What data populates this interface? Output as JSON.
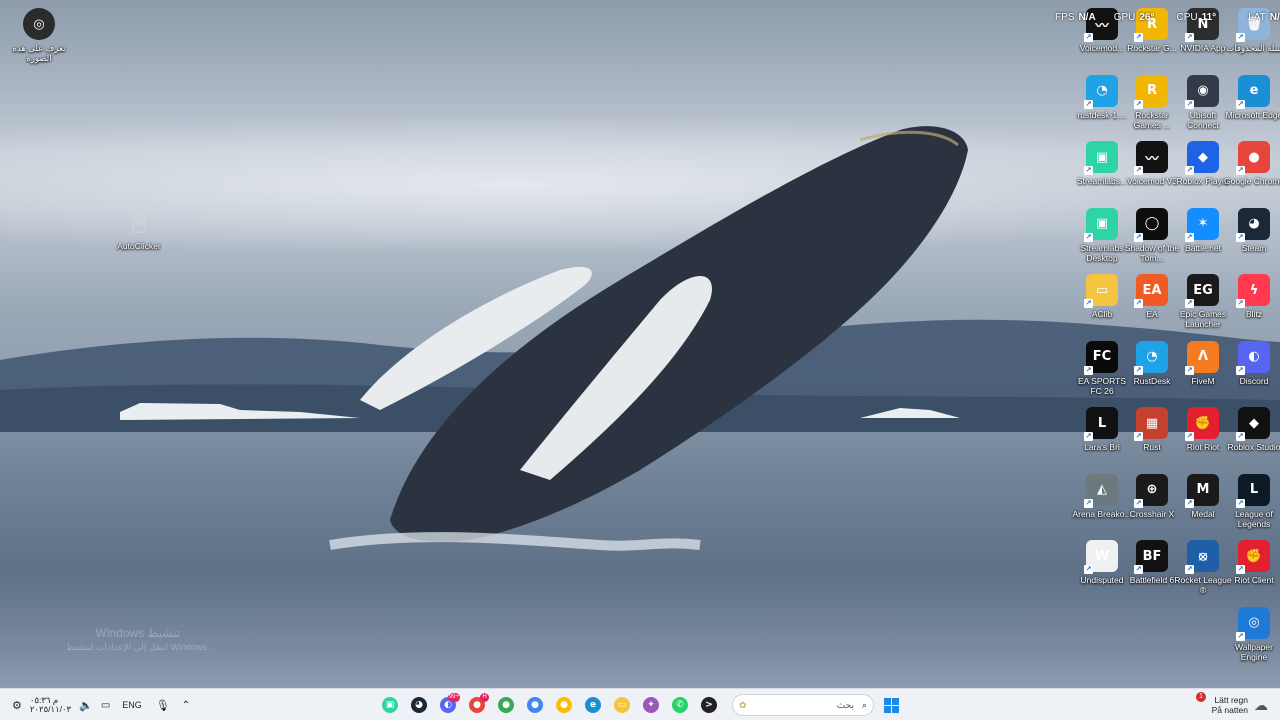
{
  "overlay": {
    "fps_label": "FPS",
    "fps_value": "N/A",
    "gpu_label": "GPU",
    "gpu_value": "26°",
    "cpu_label": "CPU",
    "cpu_value": "11°",
    "lat_label": "LAT",
    "lat_value": "N/A"
  },
  "desktop": {
    "left_icons": [
      {
        "name": "web-shortcut",
        "label": "تعرف على هذه الصورة",
        "color": "#2b2b2b",
        "glyph": "◎"
      },
      {
        "name": "autoclicker",
        "label": "AutoClicker",
        "color": "#9aa0a8",
        "glyph": "🖱"
      }
    ],
    "right_icons": [
      {
        "label": "Voicemod...",
        "color": "#121212",
        "glyph": "〰"
      },
      {
        "label": "Rockstar G...",
        "color": "#f2b705",
        "glyph": "R"
      },
      {
        "label": "NVIDIA App",
        "color": "#2d2d2d",
        "glyph": "N"
      },
      {
        "label": "سلة المحذوفات",
        "color": "#8fb4d9",
        "glyph": "🗑"
      },
      {
        "label": "rustdesk-1....",
        "color": "#1fa3e6",
        "glyph": "◔"
      },
      {
        "label": "Rockstar Games ...",
        "color": "#f2b705",
        "glyph": "R"
      },
      {
        "label": "Ubisoft Connect",
        "color": "#333a4a",
        "glyph": "◉"
      },
      {
        "label": "Microsoft Edge",
        "color": "#1b8fd6",
        "glyph": "e"
      },
      {
        "label": "Streamlabs...",
        "color": "#2fd4a4",
        "glyph": "▣"
      },
      {
        "label": "Voicemod V3",
        "color": "#121212",
        "glyph": "〰"
      },
      {
        "label": "Roblox Player",
        "color": "#1e63e6",
        "glyph": "◆"
      },
      {
        "label": "Google Chrome",
        "color": "#e8453c",
        "glyph": "●"
      },
      {
        "label": "Streamlabs Desktop",
        "color": "#2fd4a4",
        "glyph": "▣"
      },
      {
        "label": "Shadow of the Tom...",
        "color": "#0d0d0d",
        "glyph": "◯"
      },
      {
        "label": "Battle.net",
        "color": "#148eff",
        "glyph": "✶"
      },
      {
        "label": "Steam",
        "color": "#1b2838",
        "glyph": "◕"
      },
      {
        "label": "AClib",
        "color": "#f5c542",
        "glyph": "▭"
      },
      {
        "label": "EA",
        "color": "#f25a24",
        "glyph": "EA"
      },
      {
        "label": "Epic Games Launcher",
        "color": "#1a1a1a",
        "glyph": "EG"
      },
      {
        "label": "Blitz",
        "color": "#ff3a4f",
        "glyph": "ϟ"
      },
      {
        "label": "EA SPORTS FC 26",
        "color": "#0a0a0a",
        "glyph": "FC"
      },
      {
        "label": "RustDesk",
        "color": "#1fa3e6",
        "glyph": "◔"
      },
      {
        "label": "FiveM",
        "color": "#f47b20",
        "glyph": "Ʌ"
      },
      {
        "label": "Discord",
        "color": "#5865f2",
        "glyph": "◐"
      },
      {
        "label": "Lara's Bri",
        "color": "#111",
        "glyph": "L"
      },
      {
        "label": "Rust",
        "color": "#c6402e",
        "glyph": "▦"
      },
      {
        "label": "Riot Riot",
        "color": "#e2202f",
        "glyph": "✊"
      },
      {
        "label": "Roblox Studio",
        "color": "#111",
        "glyph": "◆"
      },
      {
        "label": "Arena Breako...",
        "color": "#6c7a7e",
        "glyph": "◭"
      },
      {
        "label": "Crosshair X",
        "color": "#1b1b1b",
        "glyph": "⊕"
      },
      {
        "label": "Medal",
        "color": "#1a1a1a",
        "glyph": "M"
      },
      {
        "label": "League of Legends",
        "color": "#0b1a24",
        "glyph": "L"
      },
      {
        "label": "Undisputed",
        "color": "#eef0f2",
        "glyph": "W"
      },
      {
        "label": "Battlefield 6",
        "color": "#111",
        "glyph": "BF"
      },
      {
        "label": "Rocket League ®",
        "color": "#1f5fa8",
        "glyph": "⦻"
      },
      {
        "label": "Riot Client",
        "color": "#e2202f",
        "glyph": "✊"
      },
      {
        "label": "Wallpaper Engine",
        "color": "#1f7ad6",
        "glyph": "◎"
      }
    ]
  },
  "watermark": {
    "line1": "Windows تنشيط",
    "line2": "انتقل إلى الإعدادات لتنشيط Windows."
  },
  "taskbar": {
    "clock_time": "م ٠٥:٣٦",
    "clock_date": "٢٠٢٥/١١/٠٣",
    "lang": "ENG",
    "search_placeholder": "بحث",
    "weather_line1": "Lätt regn",
    "weather_line2": "På natten",
    "weather_badge": "1",
    "apps": [
      {
        "name": "streamlabs",
        "color": "#2fd4a4",
        "glyph": "▣",
        "badge": ""
      },
      {
        "name": "steam",
        "color": "#1b2838",
        "glyph": "◕",
        "badge": ""
      },
      {
        "name": "discord",
        "color": "#5865f2",
        "glyph": "◐",
        "badge": "99+"
      },
      {
        "name": "chrome-1",
        "color": "#e8453c",
        "glyph": "●",
        "badge": "H"
      },
      {
        "name": "chrome-2",
        "color": "#3aa757",
        "glyph": "●",
        "badge": ""
      },
      {
        "name": "chrome-3",
        "color": "#4285f4",
        "glyph": "●",
        "badge": ""
      },
      {
        "name": "chrome-4",
        "color": "#fbbc05",
        "glyph": "●",
        "badge": ""
      },
      {
        "name": "edge",
        "color": "#1b8fd6",
        "glyph": "e",
        "badge": ""
      },
      {
        "name": "file-explorer",
        "color": "#f5c542",
        "glyph": "▭",
        "badge": ""
      },
      {
        "name": "copilot",
        "color": "#9b59b6",
        "glyph": "✦",
        "badge": ""
      },
      {
        "name": "whatsapp",
        "color": "#25d366",
        "glyph": "✆",
        "badge": ""
      },
      {
        "name": "terminal",
        "color": "#222",
        "glyph": ">",
        "badge": ""
      }
    ]
  }
}
